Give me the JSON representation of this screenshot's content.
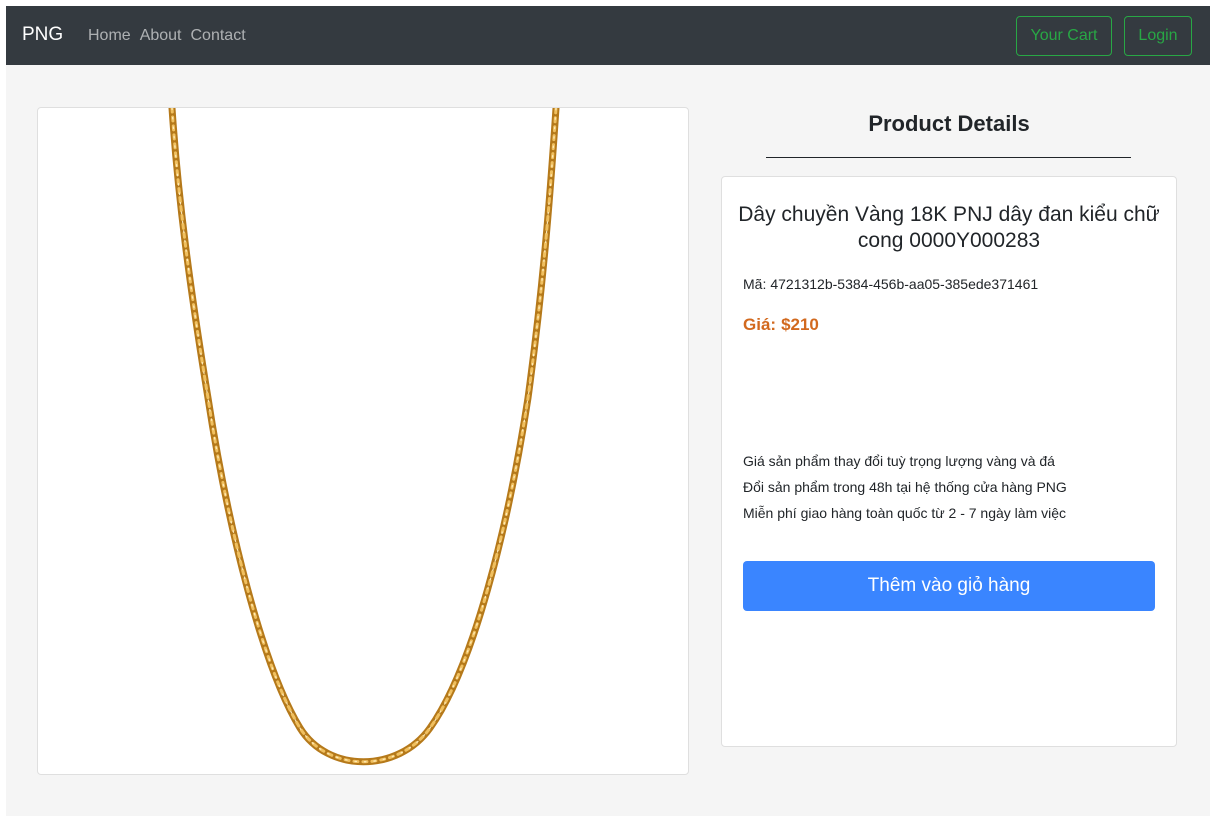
{
  "navbar": {
    "brand": "PNG",
    "links": [
      "Home",
      "About",
      "Contact"
    ],
    "cart_label": "Your Cart",
    "login_label": "Login",
    "accent_color": "#28a745",
    "background_color": "#343a40"
  },
  "product_image": {
    "subject": "gold-chain-necklace-icon"
  },
  "details": {
    "heading": "Product Details",
    "product_name": "Dây chuyền Vàng 18K PNJ dây đan kiểu chữ cong 0000Y000283",
    "code_label": "Mã:",
    "code_value": "4721312b-5384-456b-aa05-385ede371461",
    "price_label": "Giá:",
    "price_value": "$210",
    "price_color": "#d2691e",
    "policies": [
      "Giá sản phẩm thay đổi tuỳ trọng lượng vàng và đá",
      "Đổi sản phẩm trong 48h tại hệ thống cửa hàng PNG",
      "Miễn phí giao hàng toàn quốc từ 2 - 7 ngày làm việc"
    ],
    "add_to_cart_label": "Thêm vào giỏ hàng",
    "button_color": "#3a85ff"
  }
}
